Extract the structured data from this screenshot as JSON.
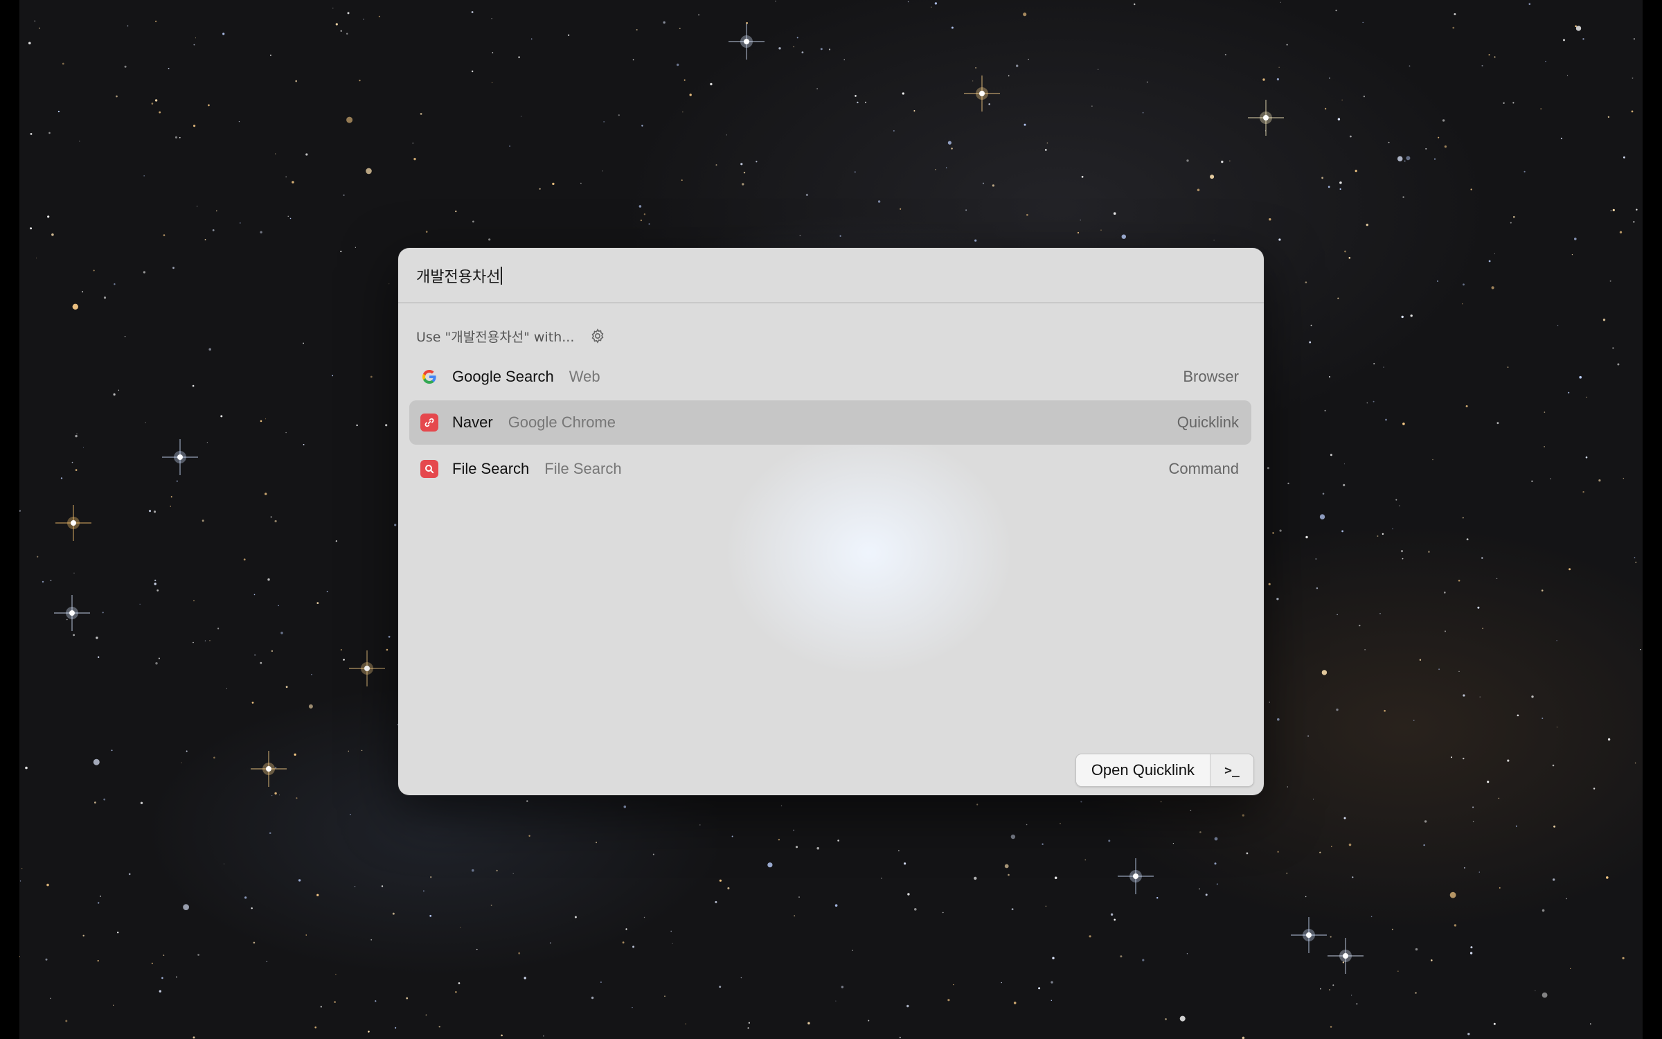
{
  "search": {
    "value": "개발전용차선",
    "placeholder": ""
  },
  "section": {
    "title": "Use \"개발전용차선\" with...",
    "settings_icon": "gear-icon"
  },
  "results": [
    {
      "icon": "google-icon",
      "title": "Google Search",
      "subtitle": "Web",
      "type": "Browser",
      "selected": false
    },
    {
      "icon": "link-icon",
      "title": "Naver",
      "subtitle": "Google Chrome",
      "type": "Quicklink",
      "selected": true
    },
    {
      "icon": "magnifier-icon",
      "title": "File Search",
      "subtitle": "File Search",
      "type": "Command",
      "selected": false
    }
  ],
  "footer": {
    "primary_action": "Open Quicklink",
    "actions_icon": "terminal-prompt-icon",
    "actions_label": ">_"
  },
  "colors": {
    "selected_row": "#c6c6c6",
    "window_bg": "#dcdcdc",
    "extension_icon_red": "#e5484d"
  }
}
